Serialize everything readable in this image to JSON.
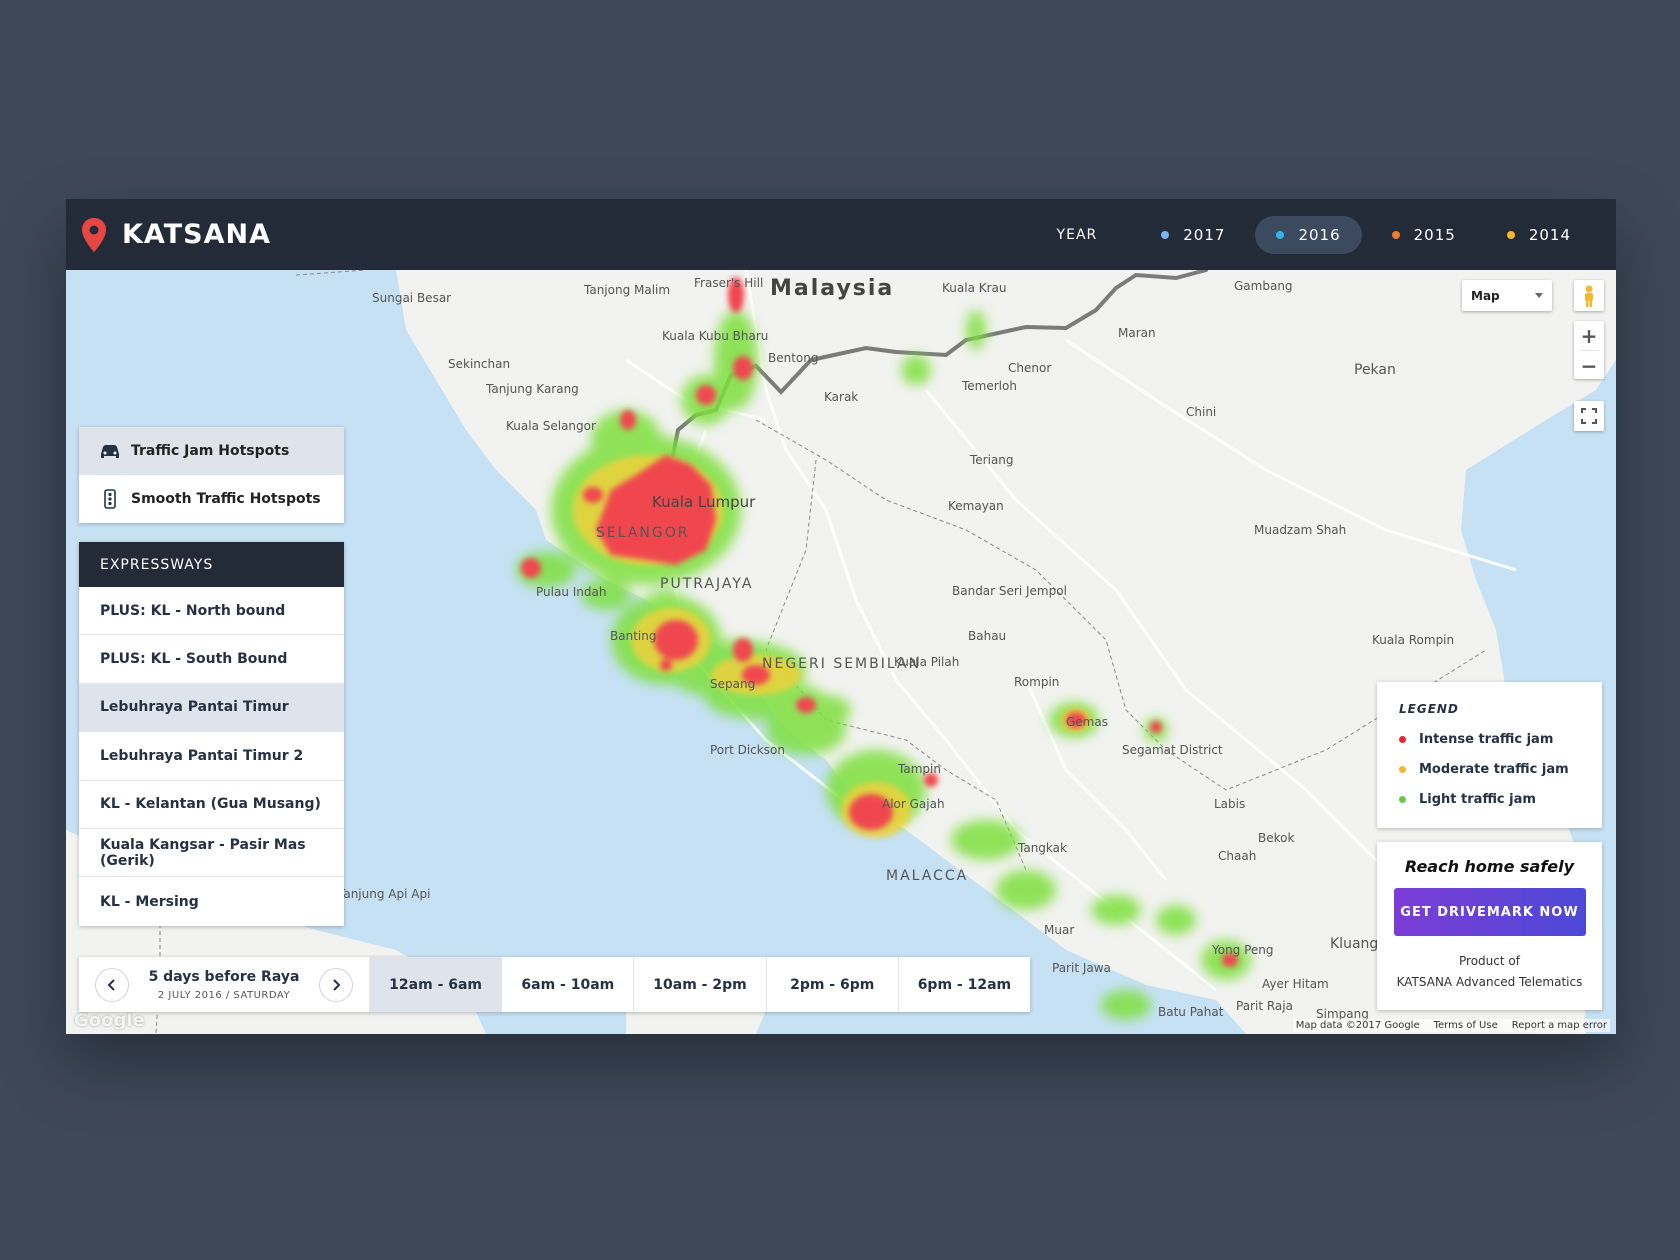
{
  "app": {
    "name": "KATSANA"
  },
  "years": {
    "label": "YEAR",
    "items": [
      {
        "label": "2017",
        "color": "#7ab6f0",
        "active": false
      },
      {
        "label": "2016",
        "color": "#33b6e6",
        "active": true
      },
      {
        "label": "2015",
        "color": "#f07b3a",
        "active": false
      },
      {
        "label": "2014",
        "color": "#f5b72d",
        "active": false
      }
    ]
  },
  "map_controls": {
    "map_type": "Map"
  },
  "hotspots": [
    {
      "label": "Traffic Jam Hotspots",
      "icon": "car-icon",
      "active": true
    },
    {
      "label": "Smooth Traffic Hotspots",
      "icon": "traffic-light-icon",
      "active": false
    }
  ],
  "expressways": {
    "title": "EXPRESSWAYS",
    "items": [
      "PLUS: KL - North bound",
      "PLUS: KL - South Bound",
      "Lebuhraya Pantai Timur",
      "Lebuhraya Pantai Timur 2",
      "KL - Kelantan (Gua Musang)",
      "Kuala Kangsar - Pasir Mas (Gerik)",
      "KL - Mersing"
    ],
    "active_index": 2
  },
  "timebar": {
    "day_title": "5 days before Raya",
    "day_sub": "2 JULY 2016 / SATURDAY",
    "slots": [
      "12am - 6am",
      "6am - 10am",
      "10am - 2pm",
      "2pm - 6pm",
      "6pm - 12am"
    ],
    "active_index": 0
  },
  "legend": {
    "title": "LEGEND",
    "items": [
      {
        "label": "Intense traffic jam",
        "color": "#e8282c"
      },
      {
        "label": "Moderate traffic jam",
        "color": "#f5b72d"
      },
      {
        "label": "Light traffic jam",
        "color": "#6cc644"
      }
    ]
  },
  "cta": {
    "title": "Reach home safely",
    "button": "GET DRIVEMARK NOW",
    "sub1": "Product of",
    "sub2": "KATSANA Advanced Telematics"
  },
  "attribution": {
    "data": "Map data ©2017 Google",
    "terms": "Terms of Use",
    "report": "Report a map error",
    "google": "Google"
  },
  "map_labels": [
    "Sungai Besar",
    "Tanjong Malim",
    "Fraser's Hill",
    "Malaysia",
    "Kuala Krau",
    "Gambang",
    "Kuala Kubu Bharu",
    "Sekinchan",
    "Bentong",
    "Maran",
    "Chenor",
    "Pekan",
    "Tanjung Karang",
    "Temerloh",
    "Karak",
    "Kuala Selangor",
    "Chini",
    "Teriang",
    "Kuala Lumpur",
    "Kemayan",
    "SELANGOR",
    "Muadzam Shah",
    "Pulau Indah",
    "PUTRAJAYA",
    "Bandar Seri Jempol",
    "Banting",
    "Bahau",
    "NEGERI SEMBILAN",
    "Kuala Pilah",
    "Kuala Rompin",
    "Sepang",
    "Rompin",
    "Gemas",
    "Port Dickson",
    "Segamat District",
    "Tampin",
    "Alor Gajah",
    "Labis",
    "Bekok",
    "Chaah",
    "Tangkak",
    "MALACCA",
    "Muar",
    "Yong Peng",
    "Kluang",
    "Parit Jawa",
    "Ayer Hitam",
    "Batu Pahat",
    "Parit Raja",
    "Simpang",
    "Tanjung Api Api"
  ]
}
